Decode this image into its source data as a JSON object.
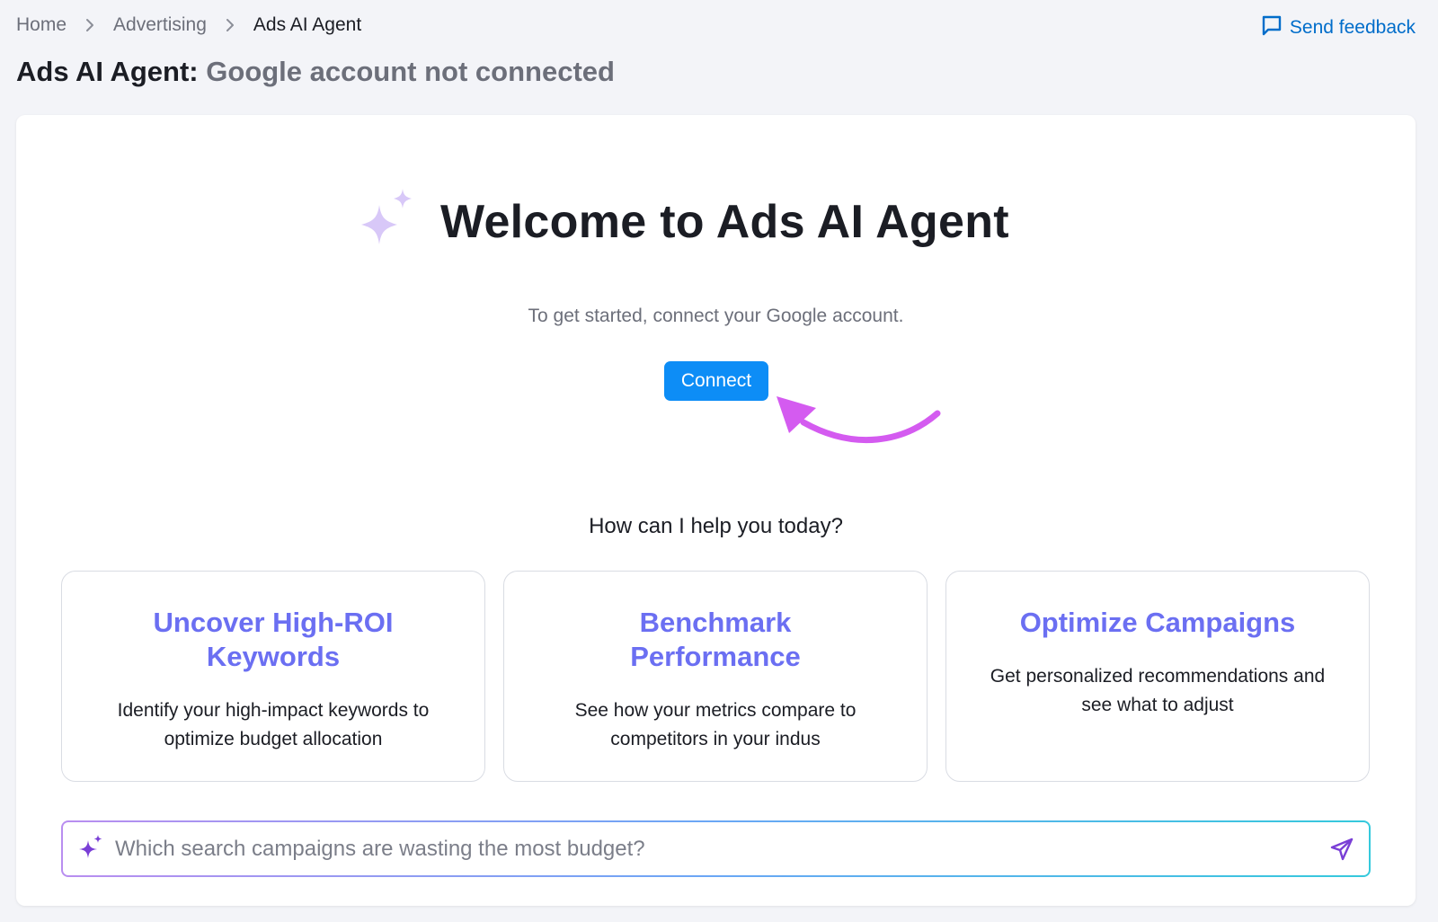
{
  "breadcrumb": {
    "home": "Home",
    "advertising": "Advertising",
    "current": "Ads AI Agent"
  },
  "feedback": {
    "label": "Send feedback"
  },
  "page": {
    "title": "Ads AI Agent:",
    "status": "Google account not connected"
  },
  "welcome": {
    "heading": "Welcome to Ads AI Agent",
    "subtitle": "To get started, connect your Google  account.",
    "connect_label": "Connect"
  },
  "help": {
    "title": "How can I help you today?",
    "tiles": [
      {
        "title": "Uncover High-ROI Keywords",
        "desc": "Identify your high-impact keywords to optimize budget allocation"
      },
      {
        "title": "Benchmark Performance",
        "desc": "See how your metrics compare to competitors in your indus"
      },
      {
        "title": "Optimize Campaigns",
        "desc": "Get personalized recommendations and see what to adjust"
      }
    ]
  },
  "prompt": {
    "placeholder": "Which search campaigns are wasting the most budget?"
  },
  "colors": {
    "accent": "#0d8df6",
    "link": "#006dca",
    "tile_title": "#6b6ff2",
    "annotation_arrow": "#d45bf0",
    "sparkle": "#d8c8f8",
    "input_gradient": [
      "#b98ef0",
      "#6aa7f5",
      "#35c9dc"
    ]
  },
  "icons": {
    "breadcrumb_separator": "chevron-right-icon",
    "feedback": "chat-bubble-icon",
    "welcome": "sparkles-icon",
    "prompt": "sparkles-icon",
    "send": "send-icon"
  }
}
